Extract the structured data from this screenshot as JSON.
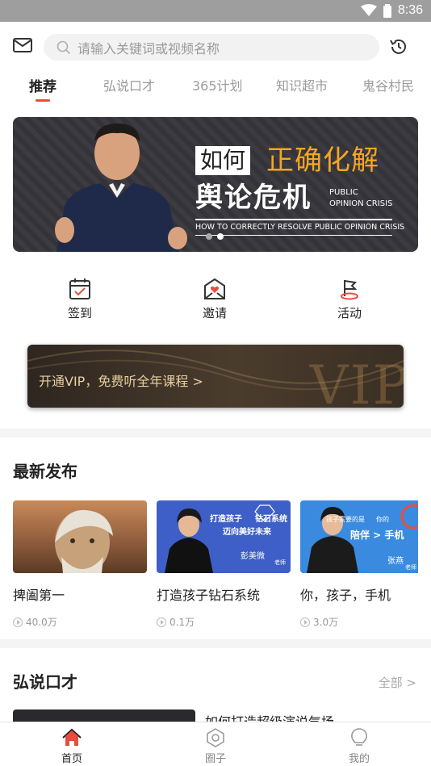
{
  "status": {
    "time": "8:36"
  },
  "header": {
    "search_placeholder": "请输入关键词或视频名称"
  },
  "tabs": [
    {
      "label": "推荐"
    },
    {
      "label": "弘说口才"
    },
    {
      "label": "365计划"
    },
    {
      "label": "知识超市"
    },
    {
      "label": "鬼谷村民"
    }
  ],
  "banner": {
    "tag_white": "如何",
    "tag_orange": "正确化解",
    "headline": "舆论危机",
    "en_line1": "PUBLIC",
    "en_line2": "OPINION CRISIS",
    "subtitle": "HOW TO CORRECTLY RESOLVE PUBLIC OPINION CRISIS"
  },
  "quick_actions": [
    {
      "label": "签到",
      "icon": "calendar-check-icon"
    },
    {
      "label": "邀请",
      "icon": "invite-heart-icon"
    },
    {
      "label": "活动",
      "icon": "flag-icon"
    }
  ],
  "vip": {
    "text": "开通VIP，免费听全年课程 >",
    "watermark": "VIP"
  },
  "latest": {
    "title": "最新发布",
    "cards": [
      {
        "title": "捭阖第一",
        "views": "40.0万"
      },
      {
        "title": "打造孩子钻石系统",
        "views": "0.1万",
        "thumb_line1": "打造孩子",
        "thumb_line1b": "钻石系统",
        "thumb_line2": "迈向美好未来",
        "thumb_name": "彭美微",
        "thumb_role": "老师"
      },
      {
        "title": "你，孩子，手机",
        "views": "3.0万",
        "thumb_line1": "孩子需要的是",
        "thumb_line1b": "你的",
        "thumb_line2": "陪伴 > 手机",
        "thumb_name": "张燕",
        "thumb_role": "老师"
      }
    ]
  },
  "speech": {
    "title": "弘说口才",
    "all": "全部 >",
    "first_item_title": "如何打造超级演说气场"
  },
  "bottom_nav": [
    {
      "label": "首页"
    },
    {
      "label": "圈子"
    },
    {
      "label": "我的"
    }
  ],
  "colors": {
    "accent": "#e84d3d",
    "vip_gold": "#e8cfa2",
    "banner_orange": "#f5a623"
  }
}
